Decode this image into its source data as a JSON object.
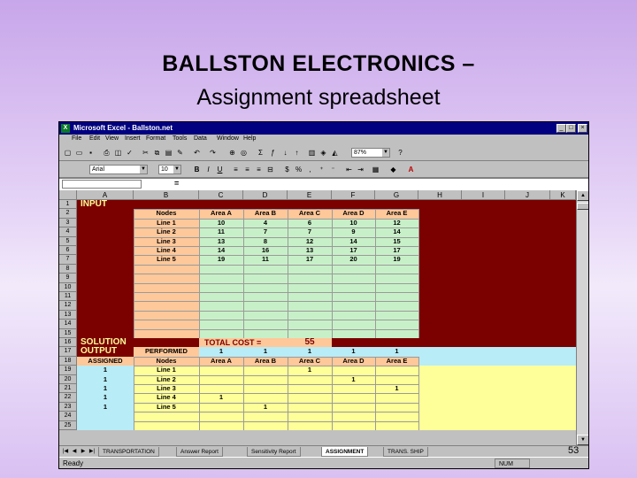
{
  "slide": {
    "title_line1": "BALLSTON  ELECTRONICS –",
    "title_line2": "Assignment spreadsheet",
    "slide_number": "53"
  },
  "window": {
    "title": "Microsoft Excel - Ballston.net",
    "menu": [
      "File",
      "Edit",
      "View",
      "Insert",
      "Format",
      "Tools",
      "Data",
      "Window",
      "Help"
    ],
    "zoom": "87%",
    "font_name": "Arial",
    "font_size": "10",
    "formula_eq": "="
  },
  "columns": [
    "A",
    "B",
    "C",
    "D",
    "E",
    "F",
    "G",
    "H",
    "I",
    "J",
    "K"
  ],
  "rows": [
    "1",
    "2",
    "3",
    "4",
    "5",
    "6",
    "7",
    "8",
    "9",
    "10",
    "11",
    "12",
    "13",
    "14",
    "15",
    "16",
    "17",
    "18",
    "19",
    "20",
    "21",
    "22",
    "23",
    "24",
    "25"
  ],
  "input": {
    "label": "INPUT",
    "headers": [
      "Nodes",
      "Area A",
      "Area B",
      "Area C",
      "Area D",
      "Area E"
    ],
    "lines": [
      {
        "name": "Line 1",
        "vals": [
          "10",
          "4",
          "6",
          "10",
          "12"
        ]
      },
      {
        "name": "Line 2",
        "vals": [
          "11",
          "7",
          "7",
          "9",
          "14"
        ]
      },
      {
        "name": "Line 3",
        "vals": [
          "13",
          "8",
          "12",
          "14",
          "15"
        ]
      },
      {
        "name": "Line 4",
        "vals": [
          "14",
          "16",
          "13",
          "17",
          "17"
        ]
      },
      {
        "name": "Line 5",
        "vals": [
          "19",
          "11",
          "17",
          "20",
          "19"
        ]
      }
    ]
  },
  "solution": {
    "label": "SOLUTION",
    "total_cost_label": "TOTAL COST =",
    "total_cost": "55"
  },
  "output": {
    "label": "OUTPUT",
    "performed_label": "PERFORMED",
    "performed": [
      "1",
      "1",
      "1",
      "1",
      "1"
    ],
    "assigned_header": "ASSIGNED",
    "headers": [
      "Nodes",
      "Area A",
      "Area B",
      "Area C",
      "Area D",
      "Area E"
    ],
    "rows": [
      {
        "assigned": "1",
        "name": "Line 1",
        "vals": [
          "",
          "",
          "1",
          "",
          ""
        ]
      },
      {
        "assigned": "1",
        "name": "Line 2",
        "vals": [
          "",
          "",
          "",
          "1",
          ""
        ]
      },
      {
        "assigned": "1",
        "name": "Line 3",
        "vals": [
          "",
          "",
          "",
          "",
          "1"
        ]
      },
      {
        "assigned": "1",
        "name": "Line 4",
        "vals": [
          "1",
          "",
          "",
          "",
          ""
        ]
      },
      {
        "assigned": "1",
        "name": "Line 5",
        "vals": [
          "",
          "1",
          "",
          "",
          ""
        ]
      }
    ]
  },
  "sheet_tabs": [
    {
      "label": "TRANSPORTATION",
      "active": false
    },
    {
      "label": "Answer Report",
      "active": false
    },
    {
      "label": "Sensitivity Report",
      "active": false
    },
    {
      "label": "ASSIGNMENT",
      "active": true
    },
    {
      "label": "TRANS. SHIP",
      "active": false
    }
  ],
  "status": {
    "ready": "Ready",
    "num": "NUM"
  },
  "colors": {
    "maroon": "#7b0000",
    "peach": "#ffc89a",
    "green": "#c8f0c8",
    "cyan": "#b8ecf6",
    "yellow": "#ffff99",
    "title_bar": "#000080"
  }
}
